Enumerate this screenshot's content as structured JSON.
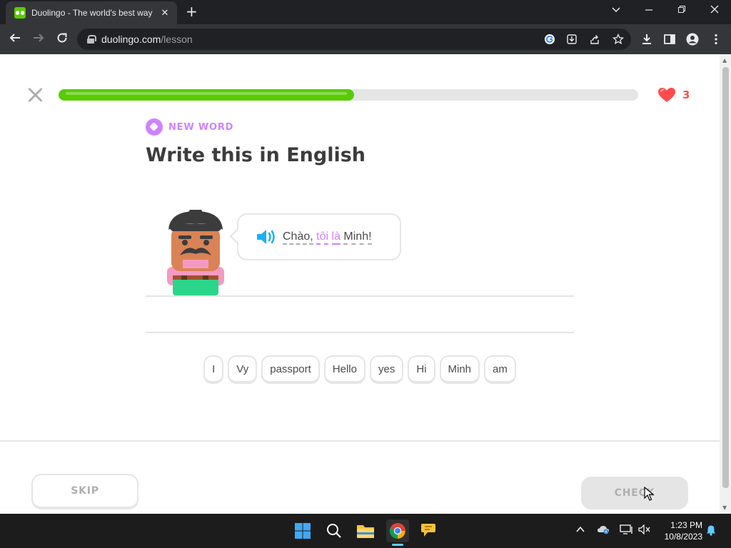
{
  "browser": {
    "tab_title": "Duolingo - The world's best way",
    "tab_close": "✕",
    "new_tab": "+",
    "url_host": "duolingo.com",
    "url_path": "/lesson"
  },
  "lesson": {
    "progress_percent": 51,
    "hearts": "3",
    "badge": "NEW WORD",
    "title": "Write this in English",
    "prompt_words": [
      "Chào,",
      "tôi",
      "là",
      "Minh!"
    ],
    "new_words": [
      1,
      2
    ],
    "word_bank": [
      "I",
      "Vy",
      "passport",
      "Hello",
      "yes",
      "Hi",
      "Minh",
      "am"
    ],
    "skip_label": "SKIP",
    "check_label": "CHECK"
  },
  "taskbar": {
    "time": "1:23 PM",
    "date": "10/8/2023"
  },
  "colors": {
    "brand_green": "#58cc02",
    "new_word_purple": "#ce82ff",
    "heart_red": "#ff4b4b",
    "speaker_blue": "#1cb0f6"
  }
}
